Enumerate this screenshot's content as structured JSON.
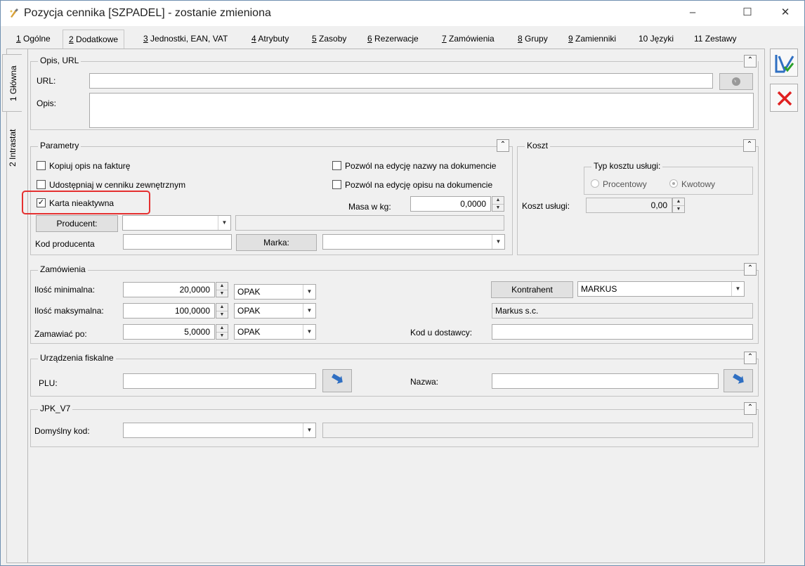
{
  "window": {
    "title": "Pozycja cennika [SZPADEL] - zostanie zmieniona",
    "minimize": "–",
    "maximize": "☐",
    "close": "✕"
  },
  "tabs": [
    {
      "num": "1",
      "label": " Ogólne"
    },
    {
      "num": "2",
      "label": " Dodatkowe"
    },
    {
      "num": "3",
      "label": " Jednostki, EAN, VAT"
    },
    {
      "num": "4",
      "label": " Atrybuty"
    },
    {
      "num": "5",
      "label": " Zasoby"
    },
    {
      "num": "6",
      "label": " Rezerwacje"
    },
    {
      "num": "7",
      "label": " Zamówienia"
    },
    {
      "num": "8",
      "label": " Grupy"
    },
    {
      "num": "9",
      "label": " Zamienniki"
    },
    {
      "num": "",
      "label": "10 Języki"
    },
    {
      "num": "",
      "label": "11 Zestawy"
    }
  ],
  "vtabs": {
    "glowna": "1 Główna",
    "intrastat": "2 Intrastat"
  },
  "opis": {
    "title": "Opis, URL",
    "url_label": "URL:",
    "url_value": "",
    "opis_label": "Opis:",
    "opis_value": ""
  },
  "parametry": {
    "title": "Parametry",
    "kopiuj": "Kopiuj opis na fakturę",
    "udostepniaj": "Udostępniaj w cenniku zewnętrznym",
    "karta": "Karta nieaktywna",
    "pozwol_nazwa": "Pozwól na edycję nazwy na dokumencie",
    "pozwol_opis": "Pozwól na edycję opisu na dokumencie",
    "masa_label": "Masa w kg:",
    "masa_value": "0,0000",
    "producent_btn": "Producent:",
    "kod_producenta_label": "Kod producenta",
    "marka_btn": "Marka:"
  },
  "koszt": {
    "title": "Koszt",
    "typ_title": "Typ kosztu usługi:",
    "procentowy": "Procentowy",
    "kwotowy": "Kwotowy",
    "koszt_label": "Koszt usługi:",
    "koszt_value": "0,00"
  },
  "zamowienia": {
    "title": "Zamówienia",
    "min_label": "Ilość minimalna:",
    "min_value": "20,0000",
    "min_unit": "OPAK",
    "max_label": "Ilość maksymalna:",
    "max_value": "100,0000",
    "max_unit": "OPAK",
    "zam_label": "Zamawiać po:",
    "zam_value": "5,0000",
    "zam_unit": "OPAK",
    "kontrahent_btn": "Kontrahent",
    "kontrahent_value": "MARKUS",
    "kontrahent_name": "Markus s.c.",
    "kod_dostawcy_label": "Kod u dostawcy:",
    "kod_dostawcy_value": ""
  },
  "fiskalne": {
    "title": "Urządzenia fiskalne",
    "plu_label": "PLU:",
    "nazwa_label": "Nazwa:"
  },
  "jpk": {
    "title": "JPK_V7",
    "kod_label": "Domyślny kod:"
  },
  "colors": {
    "highlight": "#e53030",
    "save": "#2f6fc2",
    "cancel": "#e02020"
  }
}
